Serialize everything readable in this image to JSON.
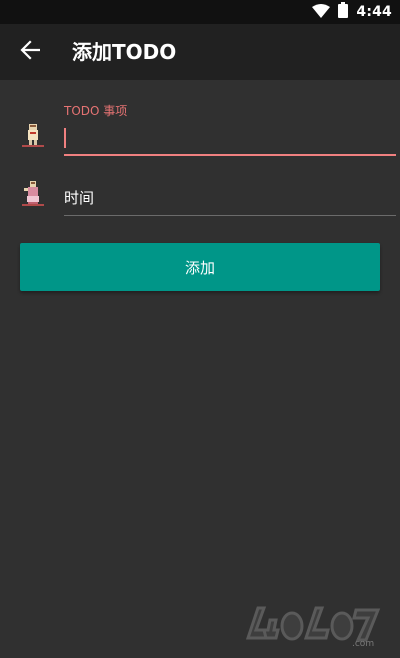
{
  "status_bar": {
    "time": "4:44",
    "icons": [
      "wifi-icon",
      "battery-icon"
    ]
  },
  "app_bar": {
    "back_icon": "arrow-back-icon",
    "title": "添加TODO"
  },
  "form": {
    "todo_field": {
      "label": "TODO 事项",
      "value": "",
      "icon": "todo-figure-icon"
    },
    "time_field": {
      "value": "时间",
      "icon": "time-figure-icon"
    },
    "submit_label": "添加"
  },
  "watermark": {
    "text": "4o4o7.com"
  },
  "colors": {
    "accent": "#f08080",
    "button": "#009688",
    "background": "#303030",
    "app_bar": "#212121"
  }
}
